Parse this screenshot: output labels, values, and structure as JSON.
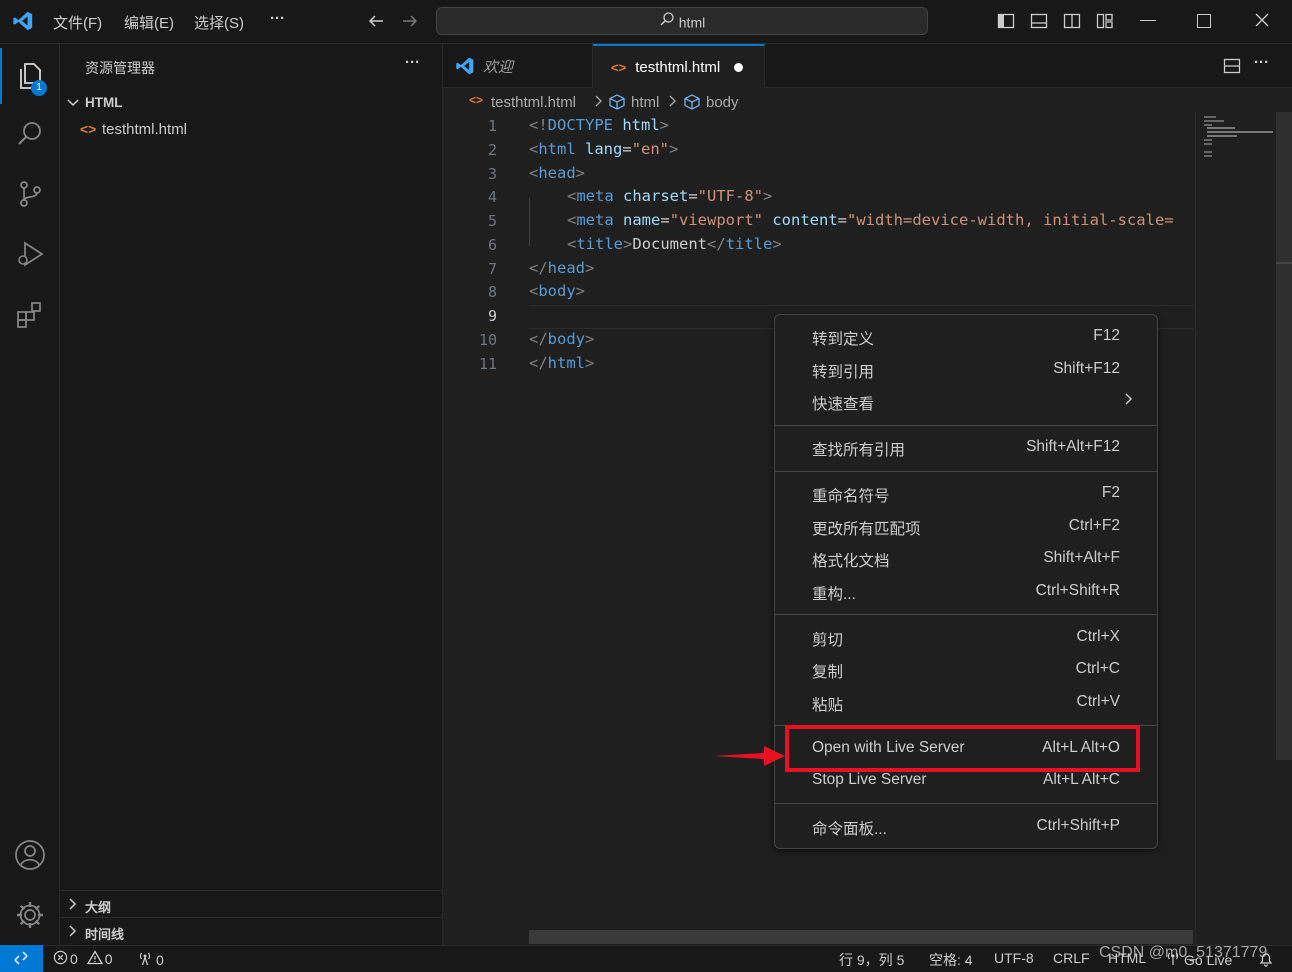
{
  "menu": {
    "file": "文件(F)",
    "edit": "编辑(E)",
    "select": "选择(S)",
    "more": "···"
  },
  "search": {
    "text": "html"
  },
  "sidebar": {
    "title": "资源管理器",
    "more": "···",
    "folder": "HTML",
    "file": "testhtml.html",
    "outline": "大纲",
    "timeline": "时间线"
  },
  "badges": {
    "explorer": "1"
  },
  "tabs": [
    {
      "label": "欢迎"
    },
    {
      "label": "testhtml.html"
    }
  ],
  "breadcrumb": {
    "file": "testhtml.html",
    "html": "html",
    "body": "body"
  },
  "code": {
    "line_numbers": [
      "1",
      "2",
      "3",
      "4",
      "5",
      "6",
      "7",
      "8",
      "9",
      "10",
      "11"
    ],
    "l1": {
      "a": "<!",
      "b": "DOCTYPE",
      "c": " html",
      "d": ">"
    },
    "l2": {
      "a": "<",
      "b": "html",
      "c": " lang",
      "d": "=",
      "e": "\"en\"",
      "f": ">"
    },
    "l3": {
      "a": "<",
      "b": "head",
      "c": ">"
    },
    "l4": {
      "a": "<",
      "b": "meta",
      "c": " charset",
      "d": "=",
      "e": "\"UTF-8\"",
      "f": ">"
    },
    "l5": {
      "a": "<",
      "b": "meta",
      "c": " name",
      "d": "=",
      "e": "\"viewport\"",
      "f": " content",
      "g": "=",
      "h": "\"width=device-width, initial-scale="
    },
    "l6": {
      "a": "<",
      "b": "title",
      "c": ">",
      "d": "Document",
      "e": "</",
      "f": "title",
      "g": ">"
    },
    "l7": {
      "a": "</",
      "b": "head",
      "c": ">"
    },
    "l8": {
      "a": "<",
      "b": "body",
      "c": ">"
    },
    "l10": {
      "a": "</",
      "b": "body",
      "c": ">"
    },
    "l11": {
      "a": "</",
      "b": "html",
      "c": ">"
    }
  },
  "context_menu": [
    {
      "label": "转到定义",
      "shortcut": "F12"
    },
    {
      "label": "转到引用",
      "shortcut": "Shift+F12"
    },
    {
      "label": "快速查看",
      "shortcut": ">"
    },
    {
      "label": "查找所有引用",
      "shortcut": "Shift+Alt+F12"
    },
    {
      "label": "重命名符号",
      "shortcut": "F2"
    },
    {
      "label": "更改所有匹配项",
      "shortcut": "Ctrl+F2"
    },
    {
      "label": "格式化文档",
      "shortcut": "Shift+Alt+F"
    },
    {
      "label": "重构...",
      "shortcut": "Ctrl+Shift+R"
    },
    {
      "label": "剪切",
      "shortcut": "Ctrl+X"
    },
    {
      "label": "复制",
      "shortcut": "Ctrl+C"
    },
    {
      "label": "粘贴",
      "shortcut": "Ctrl+V"
    },
    {
      "label": "Open with Live Server",
      "shortcut": "Alt+L Alt+O"
    },
    {
      "label": "Stop Live Server",
      "shortcut": "Alt+L Alt+C"
    },
    {
      "label": "命令面板...",
      "shortcut": "Ctrl+Shift+P"
    }
  ],
  "status": {
    "errors": "0",
    "warnings": "0",
    "ports": "0",
    "position": "行 9，列 5",
    "spaces": "空格: 4",
    "encoding": "UTF-8",
    "eol": "CRLF",
    "language": "HTML",
    "golive": "Go Live"
  },
  "watermark": "CSDN @m0_51371779",
  "colors": {
    "accent": "#0078d4",
    "highlight_box": "#e81123",
    "arrow": "#e81123"
  }
}
